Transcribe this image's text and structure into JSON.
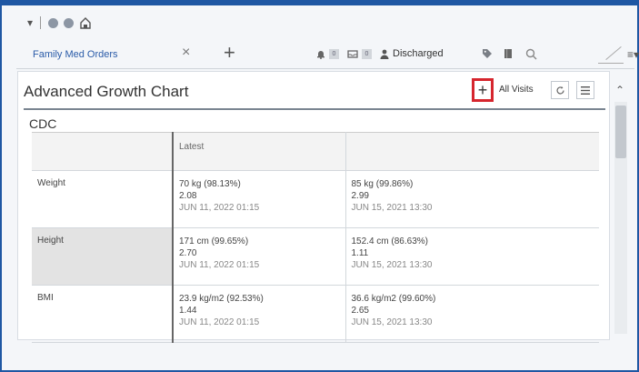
{
  "app": {
    "tab": {
      "label": "Family Med Orders",
      "close": "×",
      "add": "+"
    },
    "toolbar": {
      "badge1": "0",
      "badge2": "0",
      "discharged": "Discharged"
    }
  },
  "panel": {
    "title": "Advanced Growth Chart",
    "add_label": "+",
    "visits_label": "All Visits",
    "section": "CDC",
    "columns": [
      "",
      "Latest",
      ""
    ],
    "rows": [
      {
        "label": "Weight",
        "latest": {
          "value": "70 kg (98.13%)",
          "z": "2.08",
          "date": "JUN 11, 2022 01:15"
        },
        "prior": {
          "value": "85 kg (99.86%)",
          "z": "2.99",
          "date": "JUN 15, 2021 13:30"
        }
      },
      {
        "label": "Height",
        "latest": {
          "value": "171 cm (99.65%)",
          "z": "2.70",
          "date": "JUN 11, 2022 01:15"
        },
        "prior": {
          "value": "152.4 cm (86.63%)",
          "z": "1.11",
          "date": "JUN 15, 2021 13:30"
        }
      },
      {
        "label": "BMI",
        "latest": {
          "value": "23.9 kg/m2 (92.53%)",
          "z": "1.44",
          "date": "JUN 11, 2022 01:15"
        },
        "prior": {
          "value": "36.6 kg/m2 (99.60%)",
          "z": "2.65",
          "date": "JUN 15, 2021 13:30"
        }
      }
    ]
  },
  "icons": {
    "bell": "bell-icon",
    "inbox": "inbox-icon",
    "person": "person-icon",
    "tag": "tag-icon",
    "book": "book-icon",
    "search": "search-icon",
    "menu": "menu-icon",
    "refresh": "refresh-icon"
  },
  "colors": {
    "brand": "#1f57a3",
    "highlight": "#d6262e",
    "link": "#2a5ba8"
  }
}
